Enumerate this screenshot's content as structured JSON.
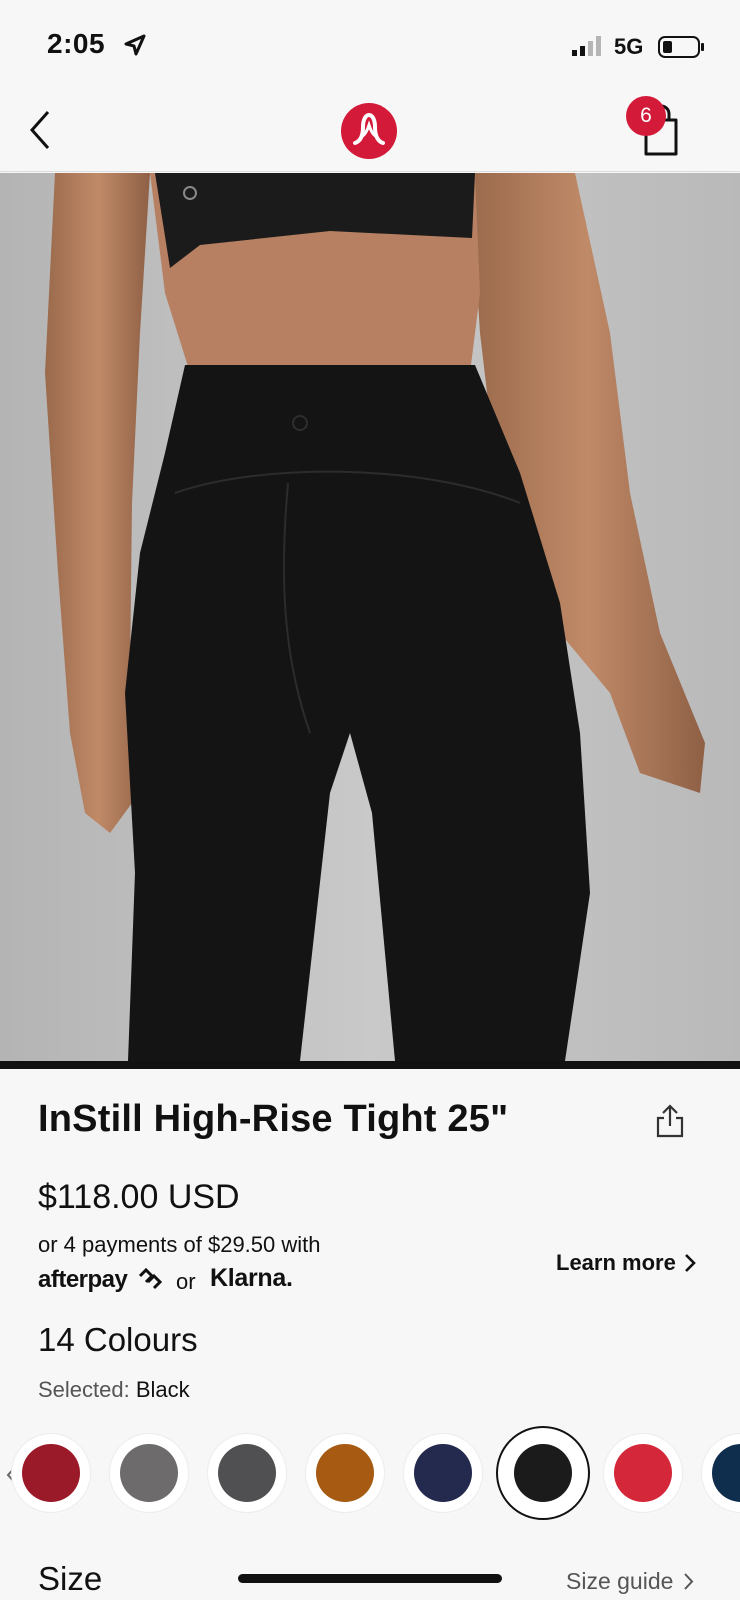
{
  "status_bar": {
    "time": "2:05",
    "network": "5G",
    "icons": [
      "location-arrow-icon",
      "signal-icon",
      "battery-icon"
    ]
  },
  "nav": {
    "icons": [
      "back-chevron-icon",
      "lululemon-logo",
      "shopping-bag-icon"
    ],
    "cart_count": "6",
    "brand_color": "#d31a38"
  },
  "product": {
    "title": "InStill High-Rise Tight 25\"",
    "price": "$118.00 USD",
    "installments_text": "or 4 payments of $29.50 with",
    "afterpay_label": "afterpay",
    "or_label": "or",
    "klarna_label": "Klarna.",
    "learn_more": "Learn more",
    "image_subject": "black high-rise leggings, back view"
  },
  "colours": {
    "count_label": "14 Colours",
    "selected_prefix": "Selected:",
    "selected_value": "Black",
    "swatches": [
      {
        "color": "#9b1a2a",
        "selected": false
      },
      {
        "color": "#6d6b6c",
        "selected": false
      },
      {
        "color": "#505052",
        "selected": false
      },
      {
        "color": "#a65a12",
        "selected": false
      },
      {
        "color": "#242a4e",
        "selected": false
      },
      {
        "color": "#1b1b1b",
        "selected": true
      },
      {
        "color": "#d4283a",
        "selected": false
      },
      {
        "color": "#0f2d4d",
        "selected": false
      }
    ]
  },
  "size": {
    "label": "Size",
    "guide_label": "Size guide"
  }
}
